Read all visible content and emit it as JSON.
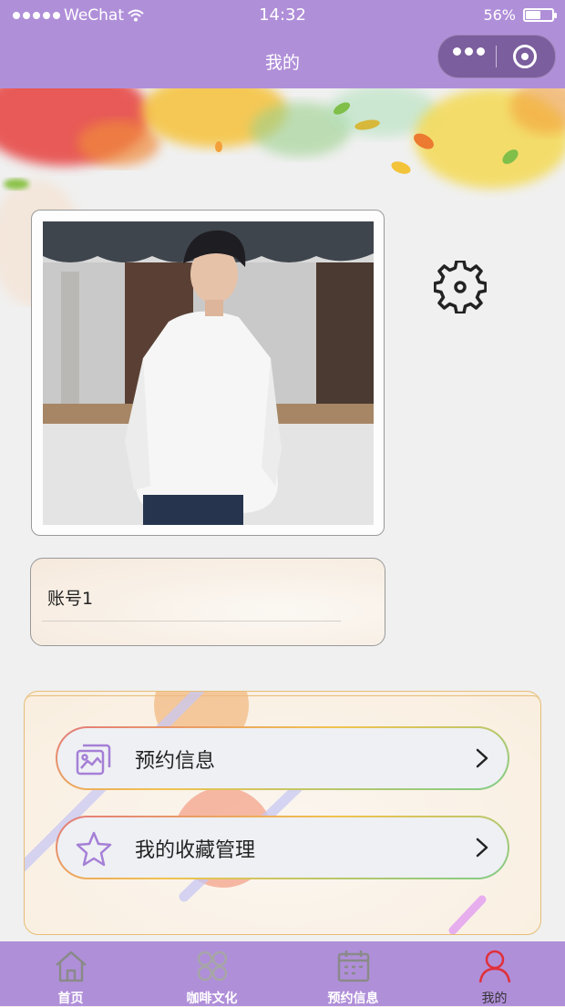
{
  "status_bar": {
    "carrier": "WeChat",
    "time": "14:32",
    "battery_percent": "56%",
    "battery_level": 0.56
  },
  "nav": {
    "title": "我的"
  },
  "profile": {
    "account_name": "账号1"
  },
  "menu": {
    "items": [
      {
        "label": "预约信息",
        "icon": "gallery-icon"
      },
      {
        "label": "我的收藏管理",
        "icon": "star-icon"
      }
    ]
  },
  "tab_bar": {
    "tabs": [
      {
        "label": "首页",
        "icon": "home-icon"
      },
      {
        "label": "咖啡文化",
        "icon": "clover-icon"
      },
      {
        "label": "预约信息",
        "icon": "calendar-icon"
      },
      {
        "label": "我的",
        "icon": "user-icon"
      }
    ],
    "active_index": 3
  },
  "colors": {
    "accent": "#b08fd9",
    "active_tab_icon": "#e0303a",
    "inactive_tab_icon": "#8a8a8a",
    "panel_border": "#e6bd76"
  }
}
